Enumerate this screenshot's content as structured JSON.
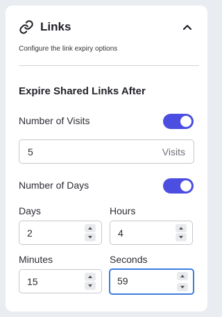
{
  "panel": {
    "title": "Links",
    "subtitle": "Configure the link expiry options",
    "icon": "link-icon",
    "collapse_icon": "chevron-up-icon"
  },
  "section": {
    "title": "Expire Shared Links After"
  },
  "visits": {
    "label": "Number of Visits",
    "toggle_on": true,
    "value": "5",
    "suffix": "Visits"
  },
  "days_toggle": {
    "label": "Number of Days",
    "toggle_on": true
  },
  "fields": {
    "days": {
      "label": "Days",
      "value": "2"
    },
    "hours": {
      "label": "Hours",
      "value": "4"
    },
    "minutes": {
      "label": "Minutes",
      "value": "15"
    },
    "seconds": {
      "label": "Seconds",
      "value": "59"
    }
  },
  "colors": {
    "accent": "#4b4ee0",
    "focus": "#3b7be0",
    "background": "#e9ecf1"
  }
}
